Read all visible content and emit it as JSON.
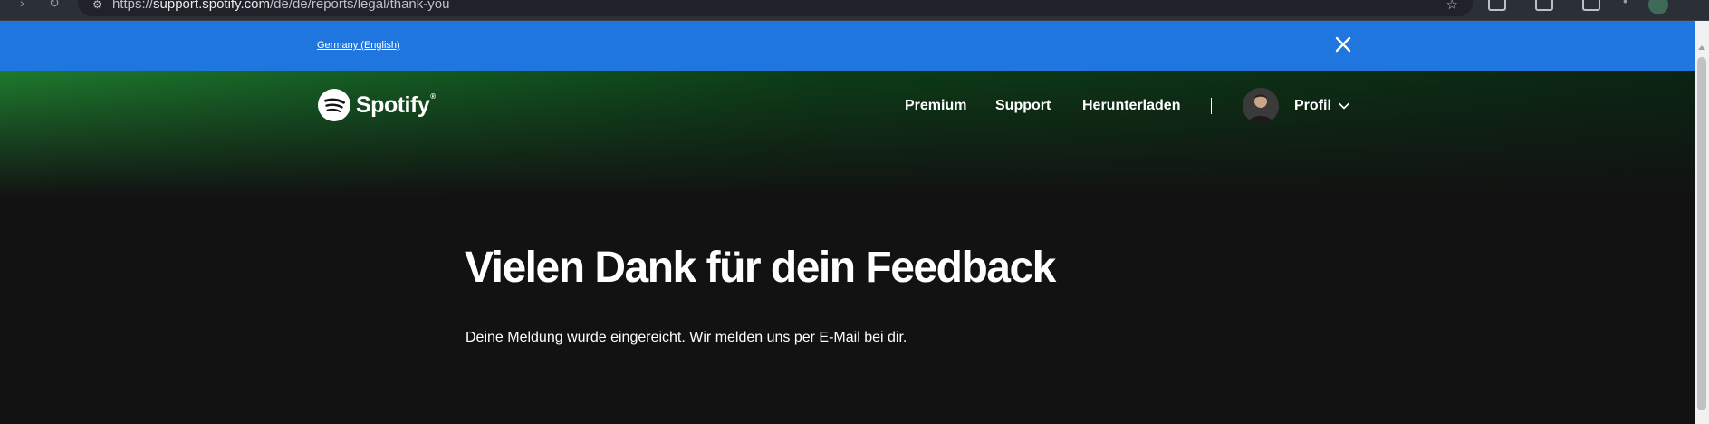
{
  "browser": {
    "url_prefix": "https://",
    "url_domain": "support.spotify.com",
    "url_path": "/de/de/reports/legal/thank-you"
  },
  "banner": {
    "region_link": "Germany (English)",
    "background_color": "#1f76de"
  },
  "header": {
    "logo_text": "Spotify",
    "logo_tm": "®",
    "nav": {
      "premium": "Premium",
      "support": "Support",
      "download": "Herunterladen"
    },
    "profile_label": "Profil"
  },
  "main": {
    "title": "Vielen Dank für dein Feedback",
    "message": "Deine Meldung wurde eingereicht. Wir melden uns per E-Mail bei dir."
  },
  "icons": {
    "close": "close-icon",
    "chevron": "chevron-down-icon",
    "logo": "spotify-logo-icon"
  },
  "colors": {
    "page_background": "#121212",
    "brand_green": "#1db954"
  }
}
